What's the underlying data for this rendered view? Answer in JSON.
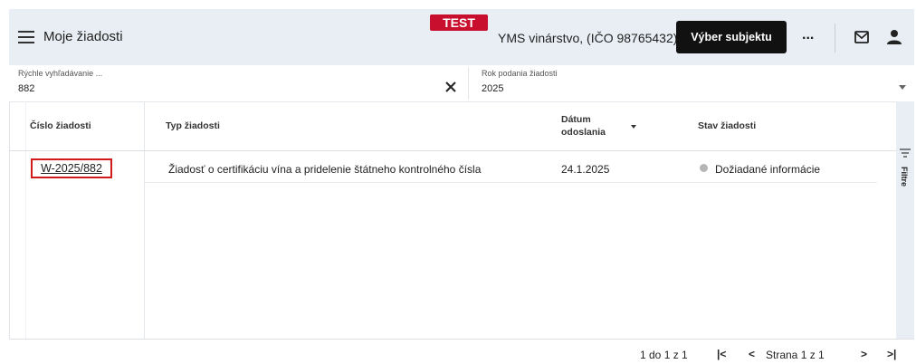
{
  "header": {
    "title": "Moje žiadosti",
    "env_badge": "TEST",
    "subject": "YMS vinárstvo, (IČO 98765432)",
    "select_subject_label": "Výber subjektu",
    "more_label": "..."
  },
  "filters": {
    "quick_search_label": "Rýchle vyhľadávanie ...",
    "quick_search_value": "882",
    "year_label": "Rok podania žiadosti",
    "year_value": "2025"
  },
  "table": {
    "columns": [
      "Číslo žiadosti",
      "Typ žiadosti",
      "Dátum odoslania",
      "Stav žiadosti"
    ],
    "rows": [
      {
        "number": "W-2025/882",
        "type": "Žiadosť o certifikáciu vína a pridelenie štátneho kontrolného čísla",
        "date": "24.1.2025",
        "status": "Dožiadané informácie"
      }
    ]
  },
  "side_panel": {
    "filters_label": "Filtre"
  },
  "pagination": {
    "range": "1 do 1 z 1",
    "page_text": "Strana 1 z 1"
  },
  "colors": {
    "accent": "#111111",
    "badge": "#c8102e",
    "header_bg": "#e9eef4",
    "highlight": "#d11a1a"
  }
}
